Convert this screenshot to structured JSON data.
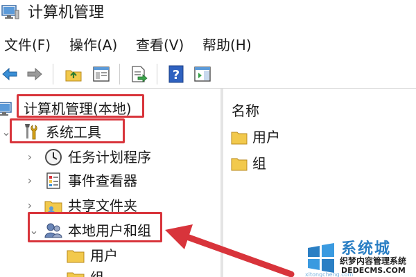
{
  "window": {
    "title": "计算机管理",
    "icon": "computer-management-icon"
  },
  "menu": {
    "items": [
      "文件(F)",
      "操作(A)",
      "查看(V)",
      "帮助(H)"
    ]
  },
  "toolbar": {
    "buttons": [
      "back-arrow-icon",
      "forward-arrow-icon",
      "up-folder-icon",
      "show-hide-tree-icon",
      "export-list-icon",
      "help-icon",
      "action-pane-icon"
    ]
  },
  "tree": {
    "root": {
      "label": "计算机管理(本地)",
      "icon": "computer-management-icon"
    },
    "system_tools": {
      "label": "系统工具",
      "icon": "tools-icon",
      "expanded": true
    },
    "children": [
      {
        "label": "任务计划程序",
        "icon": "clock-icon"
      },
      {
        "label": "事件查看器",
        "icon": "event-viewer-icon"
      },
      {
        "label": "共享文件夹",
        "icon": "shared-folder-icon"
      },
      {
        "label": "本地用户和组",
        "icon": "users-group-icon",
        "expanded": true
      }
    ],
    "subchildren": [
      {
        "label": "用户",
        "icon": "folder-icon"
      },
      {
        "label": "组",
        "icon": "folder-icon"
      }
    ]
  },
  "details": {
    "column_header": "名称",
    "rows": [
      {
        "label": "用户",
        "icon": "folder-icon"
      },
      {
        "label": "组",
        "icon": "folder-icon"
      }
    ]
  },
  "annotations": {
    "box_color": "#d8343b",
    "arrow_color": "#d8343b"
  },
  "watermark": {
    "brand": "系统城",
    "line_top": "xitongcheng.com",
    "line1": "织梦内容管理系统",
    "line2": "DEDECMS.COM"
  },
  "colors": {
    "accent": "#2b7fc4",
    "folder": "#f2c94c",
    "annotation": "#d8343b"
  }
}
